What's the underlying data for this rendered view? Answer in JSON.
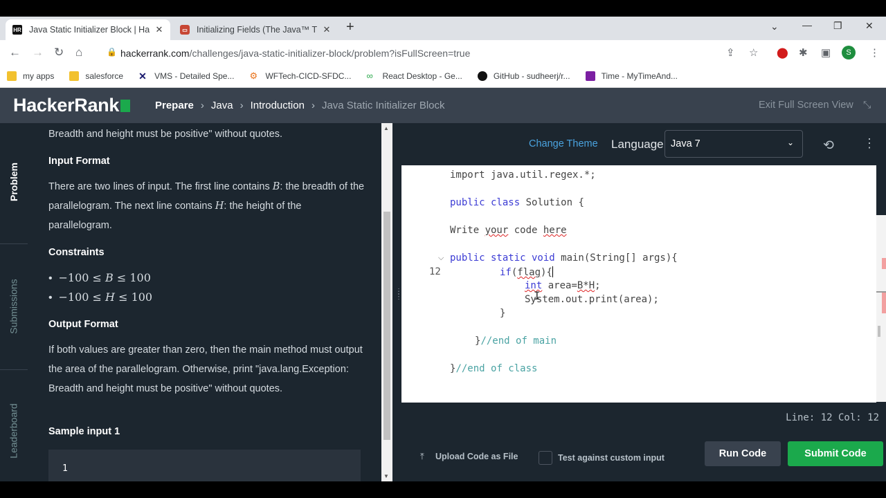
{
  "browser": {
    "tabs": [
      {
        "title": "Java Static Initializer Block | Hack",
        "favicon": "hr",
        "active": true
      },
      {
        "title": "Initializing Fields (The Java™ Tuto",
        "favicon": "oracle",
        "active": false
      }
    ],
    "url_host": "hackerrank.com",
    "url_path": "/challenges/java-static-initializer-block/problem?isFullScreen=true",
    "profile_initial": "S",
    "bookmarks": [
      {
        "label": "my apps",
        "icon_color": "#f2c12e"
      },
      {
        "label": "salesforce",
        "icon_color": "#f2c12e"
      },
      {
        "label": "VMS - Detailed Spe...",
        "icon_color": "#1a1a6e"
      },
      {
        "label": "WFTech-CICD-SFDC...",
        "icon_color": "#e8711a"
      },
      {
        "label": "React Desktop - Ge...",
        "icon_color": "#2aa84a"
      },
      {
        "label": "GitHub - sudheerj/r...",
        "icon_color": "#111111"
      },
      {
        "label": "Time - MyTimeAnd...",
        "icon_color": "#7b1fa2"
      }
    ]
  },
  "header": {
    "logo": "HackerRank",
    "breadcrumbs": [
      "Prepare",
      "Java",
      "Introduction",
      "Java Static Initializer Block"
    ],
    "exit_fullscreen": "Exit Full Screen View"
  },
  "sidebar": {
    "tabs": [
      "Problem",
      "Submissions",
      "Leaderboard"
    ]
  },
  "problem": {
    "intro": "Breadth and height must be positive\" without quotes.",
    "input_format_title": "Input Format",
    "input_format_text_1": "There are two lines of input. The first line contains ",
    "input_var_b": "B",
    "input_format_text_2": ": the breadth of the parallelogram. The next line contains ",
    "input_var_h": "H",
    "input_format_text_3": ": the height of the parallelogram.",
    "constraints_title": "Constraints",
    "constraints": [
      {
        "lo": "−100",
        "op1": " ≤ ",
        "var": "B",
        "op2": " ≤ ",
        "hi": "100"
      },
      {
        "lo": "−100",
        "op1": " ≤ ",
        "var": "H",
        "op2": " ≤ ",
        "hi": "100"
      }
    ],
    "output_format_title": "Output Format",
    "output_format_text": "If both values are greater than zero, then the main method must output the area of the parallelogram. Otherwise, print \"java.lang.Exception: Breadth and height must be positive\" without quotes.",
    "sample_input_title": "Sample input 1",
    "sample_input_first": "1"
  },
  "editor": {
    "change_theme": "Change Theme",
    "language_label": "Language",
    "language_value": "Java 7",
    "line_number": "12",
    "status": "Line: 12 Col: 12",
    "upload_label": "Upload Code as File",
    "custom_input_label": "Test against custom input",
    "run_label": "Run Code",
    "submit_label": "Submit Code",
    "code": {
      "l1": "import java.util.regex.*;",
      "l2_kw": "public class",
      "l2_rest": " Solution {",
      "l3a": "Write ",
      "l3b": "your",
      "l3c": " code ",
      "l3d": "here",
      "l4_kw": "public static void",
      "l4_rest": " main(String[] args){",
      "l5_kw": "if",
      "l5_rest_a": "(",
      "l5_flag": "flag",
      "l5_rest_b": "){",
      "l6_kw": "int",
      "l6_rest": " area=",
      "l6_bh": "B*H",
      "l6_end": ";",
      "l7": "System.out.print(area);",
      "l8": "}",
      "l9_brace": "}",
      "l9_comment": "//end of main",
      "l10_brace": "}",
      "l10_comment": "//end of class"
    }
  }
}
